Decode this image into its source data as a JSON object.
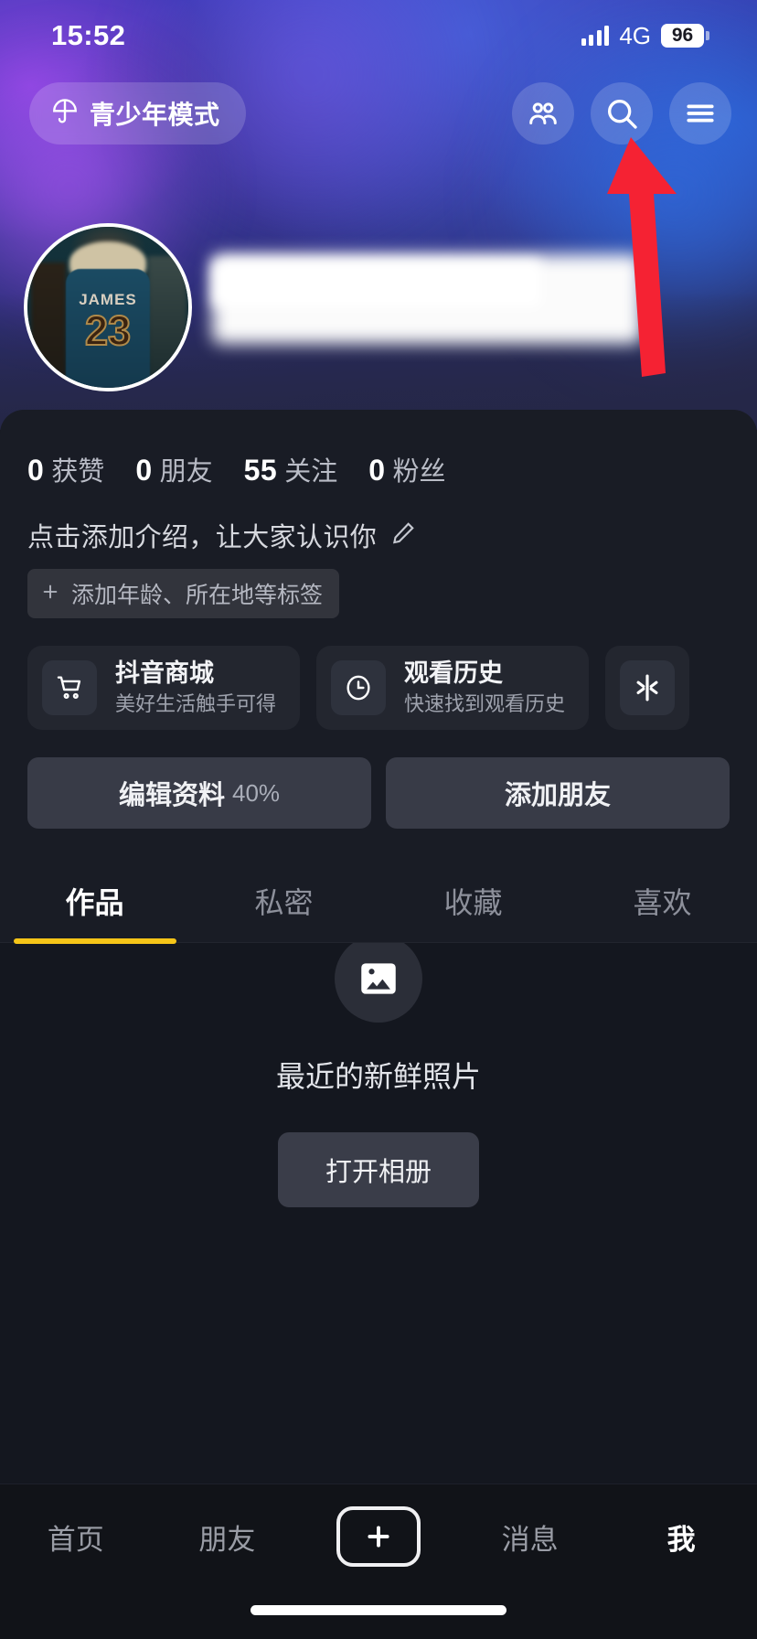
{
  "status_bar": {
    "time": "15:52",
    "network": "4G",
    "battery": "96",
    "signal_icon": "signal-bars-icon",
    "battery_icon": "battery-icon"
  },
  "top_bar": {
    "teen_mode": {
      "label": "青少年模式",
      "icon": "umbrella-icon"
    },
    "actions": [
      {
        "name": "friends-icon",
        "icon": "two-people-icon"
      },
      {
        "name": "search-icon",
        "icon": "magnifier-icon"
      },
      {
        "name": "menu-icon",
        "icon": "hamburger-icon"
      }
    ]
  },
  "profile": {
    "avatar": {
      "icon": "avatar",
      "jersey_name": "JAMES",
      "jersey_number": "23"
    },
    "username_redacted": true,
    "stats": [
      {
        "num": "0",
        "label": "获赞"
      },
      {
        "num": "0",
        "label": "朋友"
      },
      {
        "num": "55",
        "label": "关注"
      },
      {
        "num": "0",
        "label": "粉丝"
      }
    ],
    "bio_placeholder": "点击添加介绍，让大家认识你",
    "bio_edit_icon": "pencil-icon",
    "tag_add": {
      "label": "添加年龄、所在地等标签",
      "icon": "plus-icon"
    }
  },
  "shortcuts": [
    {
      "title": "抖音商城",
      "subtitle": "美好生活触手可得",
      "icon": "shopping-cart-icon"
    },
    {
      "title": "观看历史",
      "subtitle": "快速找到观看历史",
      "icon": "clock-icon"
    },
    {
      "title": "",
      "subtitle": "",
      "icon": "douyin-star-icon"
    }
  ],
  "action_buttons": {
    "edit_profile": {
      "label": "编辑资料",
      "percent": "40%"
    },
    "add_friend": {
      "label": "添加朋友"
    }
  },
  "tabs": [
    {
      "label": "作品",
      "active": true
    },
    {
      "label": "私密",
      "active": false
    },
    {
      "label": "收藏",
      "active": false
    },
    {
      "label": "喜欢",
      "active": false
    }
  ],
  "empty_state": {
    "icon": "photo-icon",
    "title": "最近的新鲜照片",
    "button": "打开相册"
  },
  "bottom_nav": [
    {
      "label": "首页",
      "active": false
    },
    {
      "label": "朋友",
      "active": false
    },
    {
      "label": "+",
      "active": false
    },
    {
      "label": "消息",
      "active": false
    },
    {
      "label": "我",
      "active": true
    }
  ],
  "annotation": {
    "arrow_color": "#f52233",
    "points_to": "menu-icon"
  },
  "colors": {
    "accent_tab": "#f5c518",
    "card_bg": "#191c25",
    "page_bg": "#14171f",
    "arrow": "#f52233"
  }
}
